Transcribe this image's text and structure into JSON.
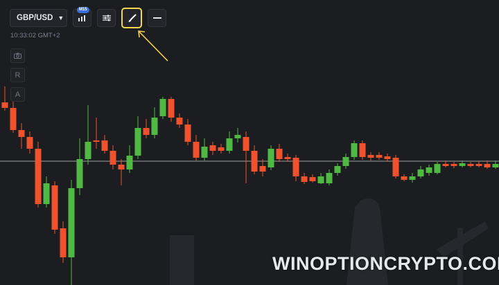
{
  "toolbar": {
    "asset_pair": "GBP/USD",
    "timeframe_badge": "M15"
  },
  "clock": "10:33:02 GMT+2",
  "side_tools": {
    "r_label": "R",
    "a_label": "A"
  },
  "watermark": "WINOPTIONCRYPTO.COM",
  "colors": {
    "background": "#1c1d21",
    "bull_candle": "#4fb944",
    "bear_candle": "#f0522e",
    "highlight": "#f5d64f",
    "price_line": "#e8e8e8"
  },
  "chart_data": {
    "type": "candlestick",
    "timeframe": "M15",
    "price_line": true
  }
}
